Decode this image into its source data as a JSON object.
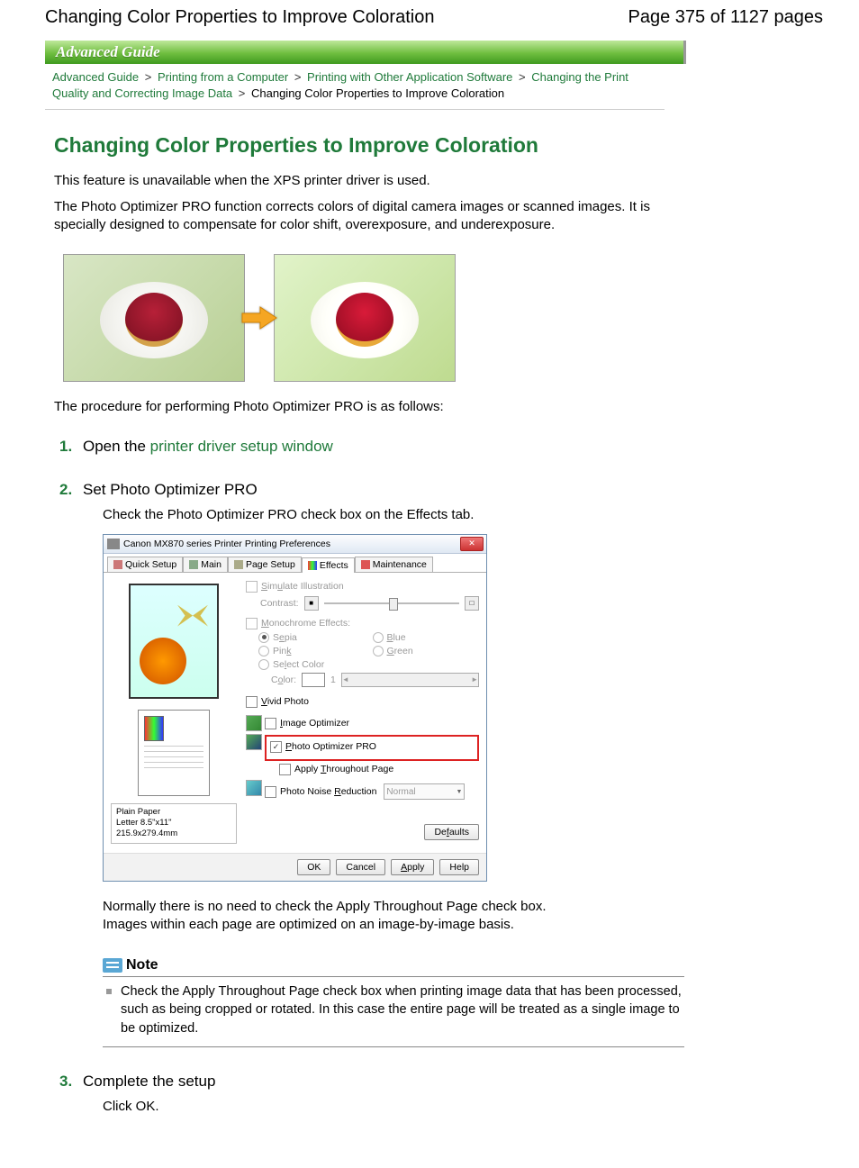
{
  "header": {
    "title": "Changing Color Properties to Improve Coloration",
    "page_info": "Page 375 of 1127 pages"
  },
  "banner": "Advanced Guide",
  "breadcrumb": {
    "items": [
      "Advanced Guide",
      "Printing from a Computer",
      "Printing with Other Application Software",
      "Changing the Print Quality and Correcting Image Data"
    ],
    "current": "Changing Color Properties to Improve Coloration",
    "sep": ">"
  },
  "content": {
    "h1": "Changing Color Properties to Improve Coloration",
    "intro1": "This feature is unavailable when the XPS printer driver is used.",
    "intro2": "The Photo Optimizer PRO function corrects colors of digital camera images or scanned images. It is specially designed to compensate for color shift, overexposure, and underexposure.",
    "procedure_lead": "The procedure for performing Photo Optimizer PRO is as follows:"
  },
  "steps": [
    {
      "num": "1.",
      "title_prefix": "Open the ",
      "title_link": "printer driver setup window"
    },
    {
      "num": "2.",
      "title": "Set Photo Optimizer PRO",
      "body1": "Check the Photo Optimizer PRO check box on the Effects tab.",
      "body2": "Normally there is no need to check the Apply Throughout Page check box.",
      "body3": "Images within each page are optimized on an image-by-image basis."
    },
    {
      "num": "3.",
      "title": "Complete the setup",
      "body1": "Click OK."
    }
  ],
  "note": {
    "label": "Note",
    "items": [
      "Check the Apply Throughout Page check box when printing image data that has been processed, such as being cropped or rotated. In this case the entire page will be treated as a single image to be optimized."
    ]
  },
  "dialog": {
    "title": "Canon MX870 series Printer Printing Preferences",
    "tabs": {
      "quick_setup": "Quick Setup",
      "main": "Main",
      "page_setup": "Page Setup",
      "effects": "Effects",
      "maintenance": "Maintenance"
    },
    "effects": {
      "simulate": "Simulate Illustration",
      "contrast": "Contrast:",
      "monochrome": "Monochrome Effects:",
      "sepia": "Sepia",
      "blue": "Blue",
      "pink": "Pink",
      "green": "Green",
      "select_color": "Select Color",
      "color": "Color:",
      "color_val": "1",
      "vivid": "Vivid Photo",
      "image_opt": "Image Optimizer",
      "photo_opt_pro": "Photo Optimizer PRO",
      "apply_throughout": "Apply Throughout Page",
      "noise": "Photo Noise Reduction",
      "noise_level": "Normal"
    },
    "paper": {
      "type": "Plain Paper",
      "size": "Letter 8.5\"x11\" 215.9x279.4mm"
    },
    "buttons": {
      "defaults": "Defaults",
      "ok": "OK",
      "cancel": "Cancel",
      "apply": "Apply",
      "help": "Help"
    }
  }
}
